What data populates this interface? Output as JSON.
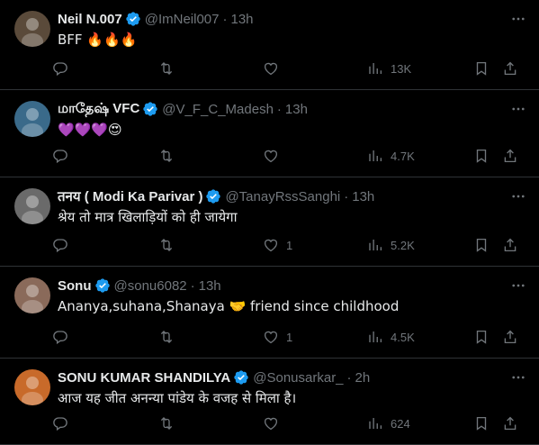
{
  "tweets": [
    {
      "name": "Neil N.007",
      "handle": "@ImNeil007",
      "dot": "·",
      "time": "13h",
      "text": "BFF 🔥🔥🔥",
      "replies": "",
      "retweets": "",
      "likes": "",
      "views": "13K",
      "avatar_color": "#5a4a3a"
    },
    {
      "name": "மாதேஷ் VFC",
      "handle": "@V_F_C_Madesh",
      "dot": "·",
      "time": "13h",
      "text": "💜💜💜😍",
      "replies": "",
      "retweets": "",
      "likes": "",
      "views": "4.7K",
      "avatar_color": "#3a6a8a"
    },
    {
      "name": "तनय ( Modi Ka Parivar )",
      "handle": "@TanayRssSanghi",
      "dot": "·",
      "time": "13h",
      "text": "श्रेय तो मात्र खिलाड़ियों को ही जायेगा",
      "replies": "",
      "retweets": "",
      "likes": "1",
      "views": "5.2K",
      "avatar_color": "#6a6a6a"
    },
    {
      "name": "Sonu",
      "handle": "@sonu6082",
      "dot": "·",
      "time": "13h",
      "text": "Ananya,suhana,Shanaya 🤝 friend since childhood",
      "replies": "",
      "retweets": "",
      "likes": "1",
      "views": "4.5K",
      "avatar_color": "#8a6a5a"
    },
    {
      "name": "SONU KUMAR SHANDILYA",
      "handle": "@Sonusarkar_",
      "dot": "·",
      "time": "2h",
      "text": "आज यह जीत अनन्या पांडेय के वजह से मिला है।",
      "replies": "",
      "retweets": "",
      "likes": "",
      "views": "624",
      "avatar_color": "#c86a2a"
    }
  ],
  "colors": {
    "accent": "#1d9bf0",
    "muted": "#71767b",
    "text": "#e7e9ea",
    "border": "#2f3336"
  },
  "icons": [
    "verified-badge-icon",
    "more-icon",
    "reply-icon",
    "retweet-icon",
    "like-icon",
    "views-icon",
    "bookmark-icon",
    "share-icon"
  ]
}
